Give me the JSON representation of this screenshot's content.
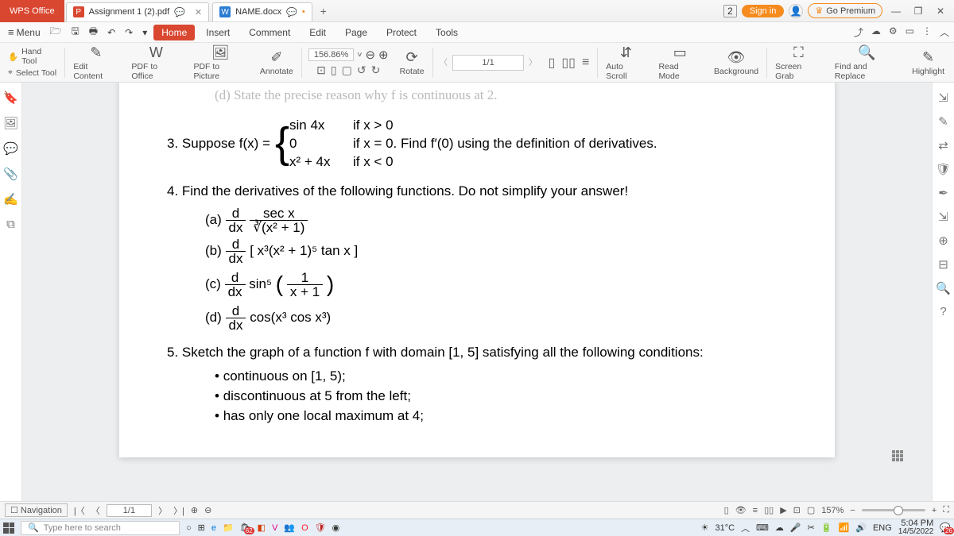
{
  "app": {
    "name": "WPS Office"
  },
  "tabs": [
    {
      "icon_color": "#d94730",
      "label": "Assignment 1 (2).pdf",
      "badge": "P"
    },
    {
      "icon_color": "#2b7cd3",
      "label": "NAME.docx",
      "badge": "W"
    }
  ],
  "title_right": {
    "doc_count": "2",
    "sign_in": "Sign in",
    "premium": "Go Premium"
  },
  "menu": {
    "menu_label": "Menu",
    "ribbon": [
      "Home",
      "Insert",
      "Comment",
      "Edit",
      "Page",
      "Protect",
      "Tools"
    ],
    "active_index": 0
  },
  "toolbar": {
    "hand": "Hand Tool",
    "select": "Select Tool",
    "edit_content": "Edit Content",
    "pdf_office": "PDF to Office",
    "pdf_picture": "PDF to Picture",
    "annotate": "Annotate",
    "zoom": "156.86%",
    "rotate": "Rotate",
    "page": "1/1",
    "auto_scroll": "Auto Scroll",
    "read_mode": "Read Mode",
    "background": "Background",
    "screen_grab": "Screen Grab",
    "find": "Find and Replace",
    "highlight": "Highlight"
  },
  "document": {
    "faded_line": "(d) State the precise reason why f is continuous at 2.",
    "q3_lead": "3. Suppose f(x) = ",
    "q3_tail": ". Find f′(0) using the definition of derivatives.",
    "piece1a": "sin 4x",
    "piece1b": "if x > 0",
    "piece2a": "0",
    "piece2b": "if x = 0",
    "piece3a": "x² + 4x",
    "piece3b": "if x < 0",
    "q4": "4. Find the derivatives of the following functions. Do not simplify your answer!",
    "q4a_label": "(a)",
    "q4a_num": "sec x",
    "q4a_den": "∛(x² + 1)",
    "q4b_label": "(b)",
    "q4b_body": "[ x³(x² + 1)⁵ tan x ]",
    "q4c_label": "(c)",
    "q4c_body_a": "sin⁵",
    "q4c_inner_num": "1",
    "q4c_inner_den": "x + 1",
    "q4d_label": "(d)",
    "q4d_body": "cos(x³ cos x³)",
    "ddx_num": "d",
    "ddx_den": "dx",
    "q5": "5. Sketch the graph of a function f with domain [1, 5] satisfying all the following conditions:",
    "q5_bullets": [
      "continuous on [1, 5);",
      "discontinuous at 5 from the left;",
      "has only one local maximum at 4;"
    ]
  },
  "status": {
    "nav": "Navigation",
    "page": "1/1",
    "zoom": "157%"
  },
  "taskbar": {
    "search": "Type here to search",
    "temp": "31°C",
    "lang": "ENG",
    "time": "5:04 PM",
    "date": "14/5/2022",
    "store_badge": "62",
    "notif_badge": "26"
  }
}
